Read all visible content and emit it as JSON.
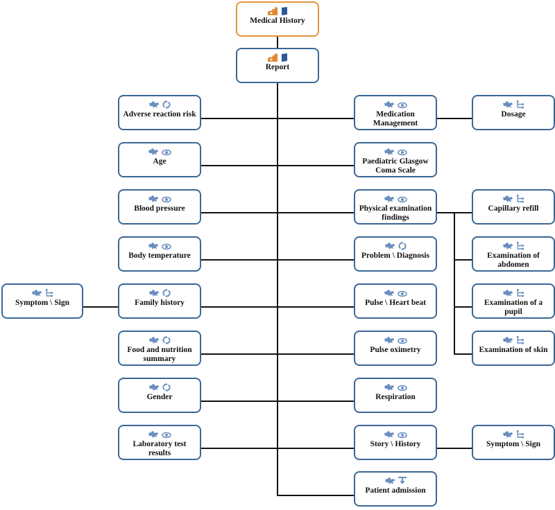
{
  "colors": {
    "node_border": "#3a6697",
    "root_border": "#e3963e",
    "icon_blue": "#6a8fbf",
    "icon_orange": "#e08a36",
    "icon_navy": "#2c5896",
    "connector": "#111111"
  },
  "root": {
    "label": "Medical History",
    "icons": [
      "puzzle-orange-icon",
      "book-icon"
    ]
  },
  "report": {
    "label": "Report",
    "icons": [
      "puzzle-orange-icon",
      "book-icon"
    ]
  },
  "left_nodes": [
    {
      "label": "Adverse reaction risk",
      "icons": [
        "puzzle-icon",
        "refresh-icon"
      ]
    },
    {
      "label": "Age",
      "icons": [
        "puzzle-icon",
        "eye-icon"
      ]
    },
    {
      "label": "Blood pressure",
      "icons": [
        "puzzle-icon",
        "eye-icon"
      ]
    },
    {
      "label": "Body temperature",
      "icons": [
        "puzzle-icon",
        "eye-icon"
      ]
    },
    {
      "label": "Family history",
      "icons": [
        "puzzle-icon",
        "refresh-icon"
      ]
    },
    {
      "label": "Food and nutrition summary",
      "icons": [
        "puzzle-icon",
        "refresh-icon"
      ]
    },
    {
      "label": "Gender",
      "icons": [
        "puzzle-icon",
        "refresh-icon"
      ]
    },
    {
      "label": "Laboratory test results",
      "icons": [
        "puzzle-icon",
        "eye-icon"
      ]
    }
  ],
  "far_left_nodes": [
    {
      "label": "Symptom \\ Sign",
      "icons": [
        "puzzle-icon",
        "tree-icon"
      ],
      "parent": "Family history"
    }
  ],
  "right_nodes": [
    {
      "label": "Medication Management",
      "icons": [
        "puzzle-icon",
        "eye-icon"
      ]
    },
    {
      "label": "Paediatric Glasgow Coma Scale",
      "icons": [
        "puzzle-icon",
        "eye-icon"
      ]
    },
    {
      "label": "Physical examination findings",
      "icons": [
        "puzzle-icon",
        "eye-icon"
      ]
    },
    {
      "label": "Problem \\ Diagnosis",
      "icons": [
        "puzzle-icon",
        "refresh-icon"
      ]
    },
    {
      "label": "Pulse \\ Heart beat",
      "icons": [
        "puzzle-icon",
        "eye-icon"
      ]
    },
    {
      "label": "Pulse oximetry",
      "icons": [
        "puzzle-icon",
        "eye-icon"
      ]
    },
    {
      "label": "Respiration",
      "icons": [
        "puzzle-icon",
        "eye-icon"
      ]
    },
    {
      "label": "Story \\ History",
      "icons": [
        "puzzle-icon",
        "eye-icon"
      ]
    },
    {
      "label": "Patient admission",
      "icons": [
        "puzzle-icon",
        "funnel-icon"
      ]
    }
  ],
  "far_right_nodes": [
    {
      "label": "Dosage",
      "icons": [
        "puzzle-icon",
        "tree-icon"
      ],
      "parent": "Medication Management"
    },
    {
      "label": "Capillary refill",
      "icons": [
        "puzzle-icon",
        "tree-icon"
      ],
      "parent": "Physical examination findings"
    },
    {
      "label": "Examination of abdomen",
      "icons": [
        "puzzle-icon",
        "tree-icon"
      ],
      "parent": "Physical examination findings"
    },
    {
      "label": "Examination of a pupil",
      "icons": [
        "puzzle-icon",
        "tree-icon"
      ],
      "parent": "Physical examination findings"
    },
    {
      "label": "Examination of skin",
      "icons": [
        "puzzle-icon",
        "tree-icon"
      ],
      "parent": "Physical examination findings"
    },
    {
      "label": "Symptom \\ Sign",
      "icons": [
        "puzzle-icon",
        "tree-icon"
      ],
      "parent": "Story \\ History"
    }
  ]
}
